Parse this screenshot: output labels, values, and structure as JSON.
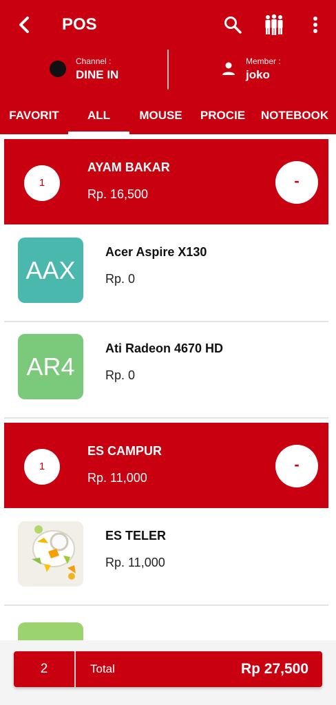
{
  "app": {
    "title": "POS"
  },
  "info": {
    "channel_label": "Channel :",
    "channel_value": "DINE IN",
    "member_label": "Member :",
    "member_value": "joko"
  },
  "tabs": [
    {
      "label": "FAVORIT"
    },
    {
      "label": "ALL",
      "active": true
    },
    {
      "label": "MOUSE"
    },
    {
      "label": "PROCIE"
    },
    {
      "label": "NOTEBOOK"
    }
  ],
  "items": [
    {
      "type": "selected",
      "name": "AYAM BAKAR",
      "price": "Rp. 16,500",
      "qty": "1",
      "minus": "-"
    },
    {
      "type": "product",
      "initials": "AAX",
      "name": "Acer Aspire X130",
      "price": "Rp. 0",
      "color": "#4bb8ae"
    },
    {
      "type": "product",
      "initials": "AR4",
      "name": "Ati Radeon 4670 HD",
      "price": "Rp. 0",
      "color": "#7bc97b"
    },
    {
      "type": "selected",
      "name": "ES CAMPUR",
      "price": "Rp. 11,000",
      "qty": "1",
      "minus": "-"
    },
    {
      "type": "product",
      "image": "food-photo",
      "name": "ES TELER",
      "price": "Rp. 11,000"
    }
  ],
  "checkout": {
    "count": "2",
    "label": "Total",
    "total": "Rp 27,500"
  },
  "colors": {
    "primary": "#c8000f",
    "accent_teal": "#4bb8ae",
    "accent_green": "#7bc97b"
  },
  "icons": [
    "back-arrow-icon",
    "search-icon",
    "group-icon",
    "more-vertical-icon",
    "person-icon"
  ]
}
